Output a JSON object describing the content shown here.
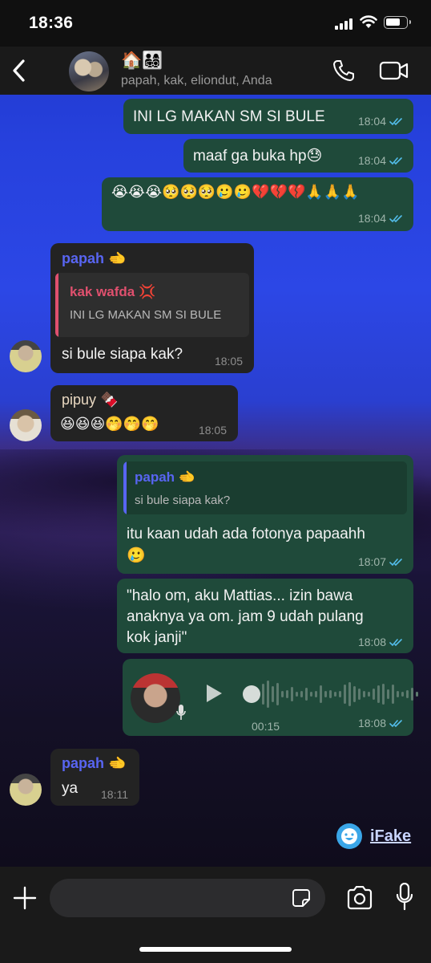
{
  "status_bar": {
    "time": "18:36"
  },
  "header": {
    "group_name": "🏠👨‍👩‍👧‍👦",
    "members": "papah, kak, eliondut, Anda"
  },
  "messages": [
    {
      "type": "out",
      "text": "INI LG MAKAN SM SI BULE",
      "time": "18:04"
    },
    {
      "type": "out",
      "text": "maaf ga buka hp😓",
      "time": "18:04"
    },
    {
      "type": "out",
      "text": "😭😭😭🥺🥺🥺🥲🥲💔💔💔🙏🙏🙏",
      "time": "18:04"
    },
    {
      "type": "in",
      "sender": "papah 🫲",
      "quote_sender": "kak wafda 💢",
      "quote_text": "INI LG MAKAN SM SI BULE",
      "text": "si bule siapa kak?",
      "time": "18:05"
    },
    {
      "type": "in",
      "sender": "pipuy 🍫",
      "text": "😆😆😆🤭🤭🤭",
      "time": "18:05"
    },
    {
      "type": "out",
      "quote_sender": "papah 🫲",
      "quote_text": "si bule siapa kak?",
      "text_line1": "itu kaan udah ada fotonya papaahh",
      "text_line2": "🥲",
      "time": "18:07"
    },
    {
      "type": "out",
      "text_lines": [
        "\"halo om, aku Mattias... izin bawa",
        "anaknya ya om. jam 9 udah pulang",
        "kok janji\""
      ],
      "time": "18:08"
    },
    {
      "type": "out_voice",
      "duration": "00:15",
      "time": "18:08"
    },
    {
      "type": "in",
      "sender": "papah 🫲",
      "text": "ya",
      "time": "18:11"
    }
  ],
  "watermark": {
    "label": "iFake"
  },
  "input": {
    "placeholder": ""
  },
  "colors": {
    "outgoing_bubble": "#1f4a3a",
    "incoming_bubble": "#232323",
    "read_ticks": "#53bdeb",
    "sender_papah": "#5865f2",
    "sender_pipuy": "#e8d7c0",
    "quote_kak": "#e0506e"
  }
}
